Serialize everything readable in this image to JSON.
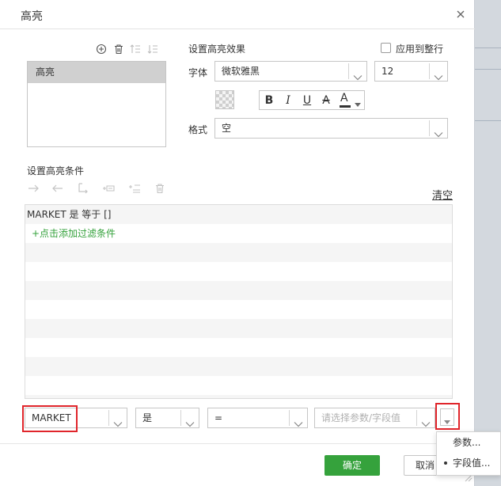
{
  "dialog": {
    "title": "高亮",
    "close_icon": "close-icon"
  },
  "highlight_list": {
    "toolbar_icons": [
      "add-icon",
      "delete-icon",
      "move-up-icon",
      "move-down-icon"
    ],
    "items": [
      "高亮"
    ]
  },
  "effect": {
    "section_label": "设置高亮效果",
    "apply_row_label": "应用到整行",
    "apply_row_checked": false,
    "font_label": "字体",
    "font_family_value": "微软雅黑",
    "font_size_value": "12",
    "format_buttons": [
      "B",
      "I",
      "U",
      "A"
    ],
    "font_color_label": "A",
    "format_label": "格式",
    "format_value": "空",
    "font_color": "#333333"
  },
  "conditions": {
    "section_label": "设置高亮条件",
    "toolbar_icons": [
      "arrow-right-icon",
      "arrow-left-icon",
      "swap-icon",
      "insert-condition-icon",
      "add-condition-icon",
      "delete-condition-icon"
    ],
    "clear_label": "清空",
    "rows": [
      "MARKET 是 等于 []"
    ],
    "add_filter_label": "+点击添加过滤条件"
  },
  "editor": {
    "field_value": "MARKET",
    "operator_value": "是",
    "compare_value": "=",
    "value_placeholder": "请选择参数/字段值"
  },
  "value_menu": {
    "items": [
      {
        "label": "参数...",
        "active": false
      },
      {
        "label": "字段值...",
        "active": true
      }
    ]
  },
  "footer": {
    "ok_label": "确定",
    "cancel_label": "取消"
  },
  "colors": {
    "accent_green": "#35a23c",
    "highlight_red": "#e0252b",
    "selected_item_bg": "#d0d0d0"
  }
}
